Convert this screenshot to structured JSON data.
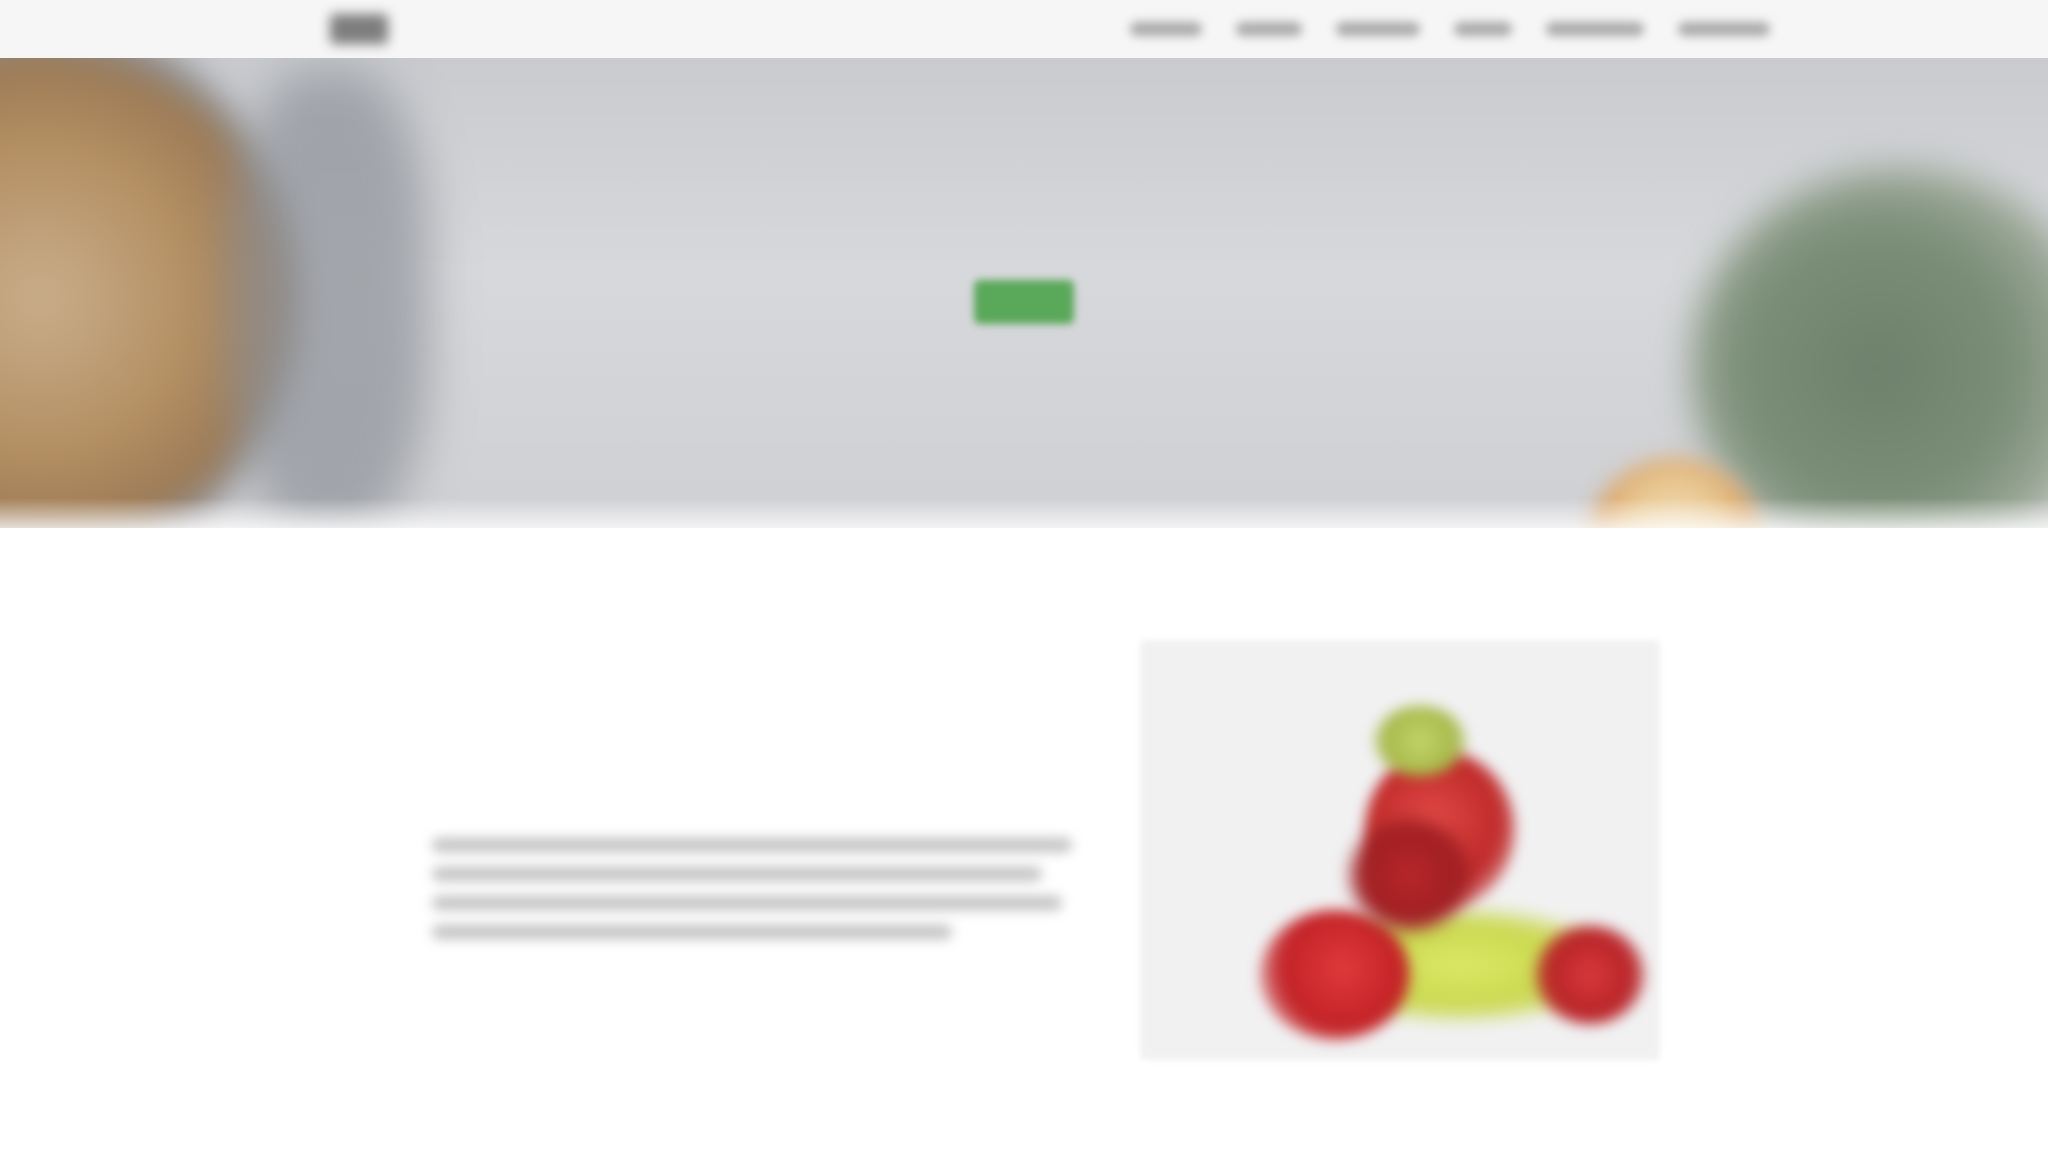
{
  "header": {
    "nav_items": [
      "",
      "",
      "",
      "",
      "",
      ""
    ]
  },
  "hero": {
    "title": "",
    "subtitle": "",
    "button_label": "",
    "button_color": "#5aa85a"
  },
  "about": {
    "eyebrow": "",
    "heading": "",
    "body": "",
    "image_alt": ""
  },
  "footer_cta": {
    "label": ""
  }
}
